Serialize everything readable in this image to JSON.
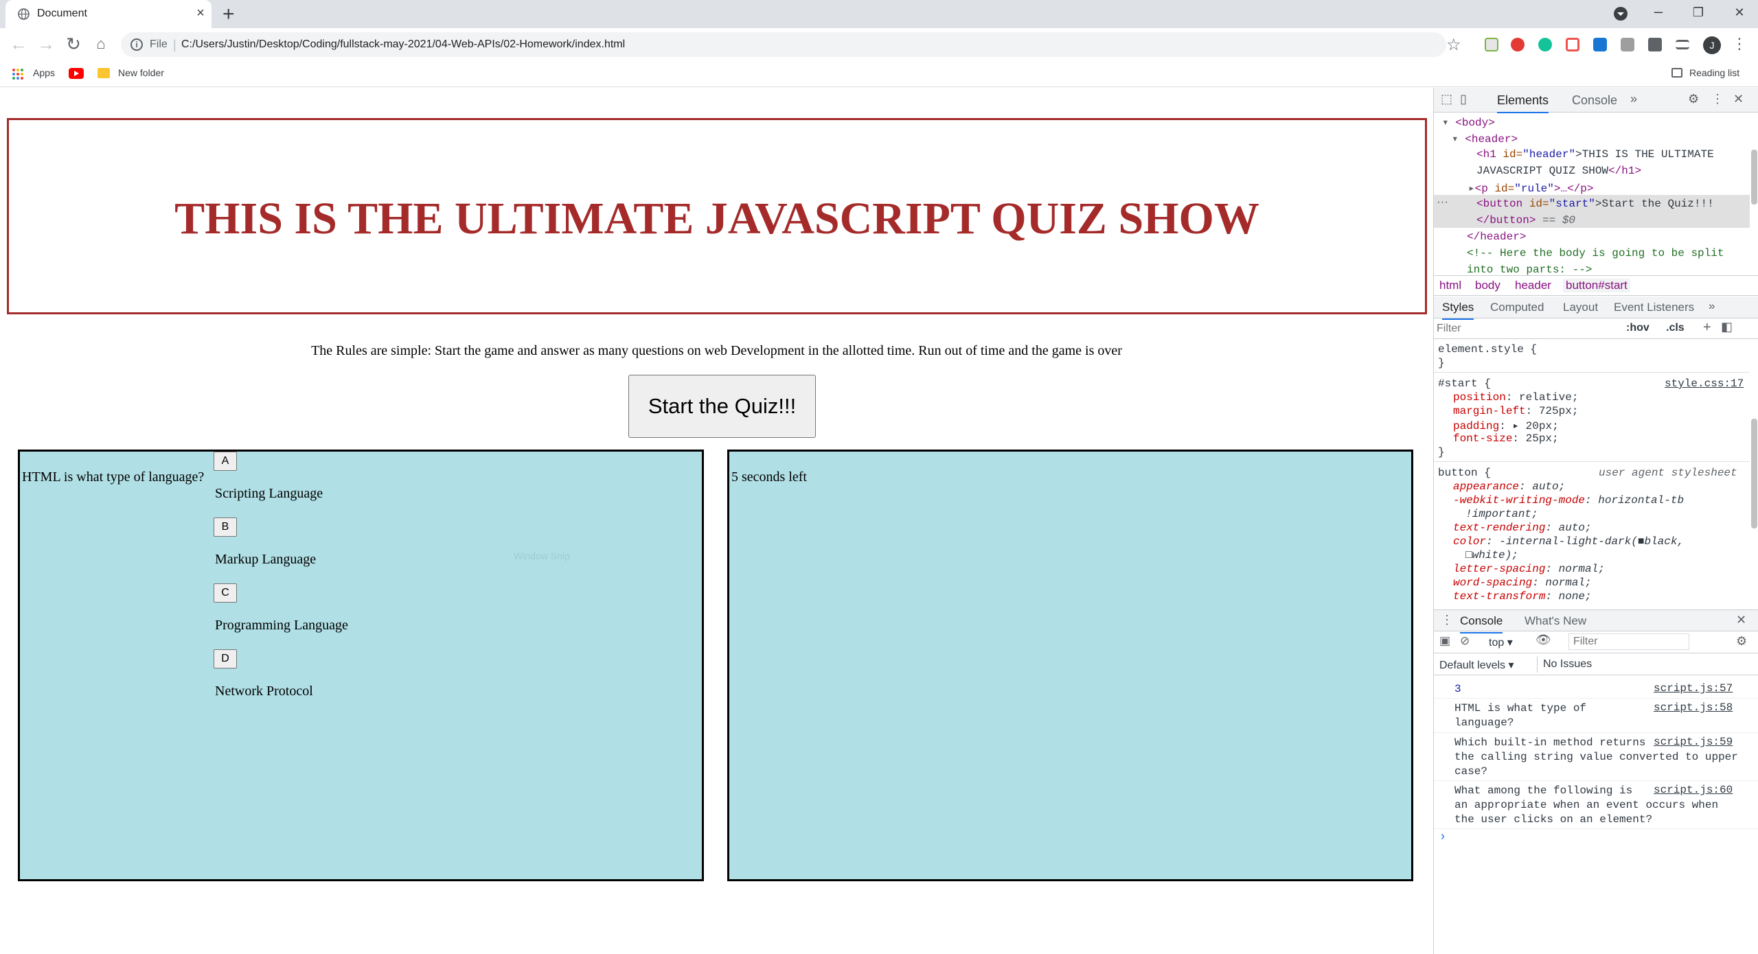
{
  "browser": {
    "tab_title": "Document",
    "tab_close": "×",
    "new_tab": "+",
    "address_scheme": "File",
    "address_url": "C:/Users/Justin/Desktop/Coding/fullstack-may-2021/04-Web-APIs/02-Homework/index.html",
    "avatar_initial": "J",
    "bookmarks": {
      "apps": "Apps",
      "new_folder": "New folder",
      "reading_list": "Reading list"
    },
    "window_controls": {
      "minimize": "–",
      "restore": "❐",
      "close": "✕"
    }
  },
  "page": {
    "header_title": "THIS IS THE ULTIMATE JAVASCRIPT QUIZ SHOW",
    "rule_text": "The Rules are simple: Start the game and answer as many questions on web Development in the allotted time. Run out of time and the game is over",
    "start_button": "Start the Quiz!!!",
    "question": "HTML is what type of language?",
    "answers": [
      {
        "letter": "A",
        "text": "Scripting Language"
      },
      {
        "letter": "B",
        "text": "Markup Language"
      },
      {
        "letter": "C",
        "text": "Programming Language"
      },
      {
        "letter": "D",
        "text": "Network Protocol"
      }
    ],
    "timer_text": "5 seconds left",
    "ghost_overlay": "Window Snip"
  },
  "devtools": {
    "tabs": {
      "elements": "Elements",
      "console": "Console",
      "more": "»"
    },
    "dom": {
      "body_open": "<body>",
      "header_open": "<header>",
      "h1_tag": "<h1",
      "h1_id_attr": "id=",
      "h1_id_val": "\"header\"",
      "h1_text_1": ">THIS IS THE ULTIMATE",
      "h1_text_2": "JAVASCRIPT QUIZ SHOW",
      "h1_close": "</h1>",
      "p_tag": "<p",
      "p_id_val": "\"rule\"",
      "p_rest": ">…</p>",
      "button_tag": "<button",
      "button_id_val": "\"start\"",
      "button_text": ">Start the Quiz!!!",
      "button_close": "</button>",
      "button_eq": " == $0",
      "header_close": "</header>",
      "comment_1": "<!-- Here the body is going to be split",
      "comment_2": "into two parts: -->"
    },
    "breadcrumbs": [
      "html",
      "body",
      "header",
      "button#start"
    ],
    "style_tabs": [
      "Styles",
      "Computed",
      "Layout",
      "Event Listeners",
      "»"
    ],
    "filter_placeholder": "Filter",
    "hov": ":hov",
    "cls": ".cls",
    "styles": {
      "element_style": "element.style {",
      "close_brace": "}",
      "start_selector": "#start {",
      "start_source": "style.css:17",
      "start_props": [
        {
          "name": "position",
          "value": "relative;"
        },
        {
          "name": "margin-left",
          "value": "725px;"
        },
        {
          "name": "padding",
          "value": "▸ 20px;"
        },
        {
          "name": "font-size",
          "value": "25px;"
        }
      ],
      "button_selector": "button {",
      "button_source": "user agent stylesheet",
      "button_props": [
        {
          "name": "appearance",
          "value": "auto;"
        },
        {
          "name": "-webkit-writing-mode",
          "value": "horizontal-tb"
        },
        {
          "name": "",
          "value": "!important;"
        },
        {
          "name": "text-rendering",
          "value": "auto;"
        },
        {
          "name": "color",
          "value": "-internal-light-dark(■black,"
        },
        {
          "name": "",
          "value": "□white);"
        },
        {
          "name": "letter-spacing",
          "value": "normal;"
        },
        {
          "name": "word-spacing",
          "value": "normal;"
        },
        {
          "name": "text-transform",
          "value": "none;"
        }
      ]
    },
    "drawer": {
      "tabs": [
        "Console",
        "What's New"
      ],
      "context": "top",
      "filter_placeholder": "Filter",
      "levels": "Default levels",
      "issues": "No Issues",
      "messages": [
        {
          "text": "3",
          "src": "script.js:57"
        },
        {
          "text": "HTML is what type of\nlanguage?",
          "src": "script.js:58"
        },
        {
          "text": "Which built-in method returns\nthe calling string value converted to upper\ncase?",
          "src": "script.js:59"
        },
        {
          "text": "What among the following is\nan appropriate when an event occurs when\nthe user clicks on an element?",
          "src": "script.js:60"
        }
      ],
      "prompt": "›"
    }
  },
  "colors": {
    "header_red": "#a52a2a",
    "panel_blue": "#b0dfe5",
    "tab_strip": "#dee1e6"
  }
}
